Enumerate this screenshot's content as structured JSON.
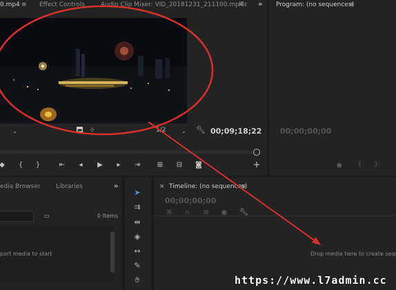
{
  "source_panel": {
    "tabs": [
      "0.mp4",
      "Effect Controls",
      "Audio Clip Mixer: VID_20181231_211100.mp4",
      "Mε"
    ],
    "menu_icon": "hamburger-icon",
    "overflow_icon": "double-chevron-right-icon",
    "timecode": "00;09;18;22",
    "resolution": "1/2",
    "controls": [
      "mark-in",
      "mark-out",
      "go-to-in",
      "step-back",
      "play",
      "step-forward",
      "go-to-out",
      "insert",
      "overwrite",
      "export-frame",
      "add"
    ]
  },
  "program_panel": {
    "title": "Program: (no sequences)",
    "menu_icon": "hamburger-icon",
    "timecode": "00;00;00;00"
  },
  "project_panel": {
    "tabs": [
      "edia Browser",
      "Libraries"
    ],
    "overflow_icon": "double-chevron-right-icon",
    "items_count": "0 Items",
    "empty_text": "port media to start"
  },
  "timeline_panel": {
    "title": "Timeline: (no sequences)",
    "close_icon": "close-icon",
    "menu_icon": "hamburger-icon",
    "timecode": "00;00;00;00",
    "drop_text": "Drop media here to create seque"
  },
  "tools": [
    "selection-tool",
    "track-select-tool",
    "ripple-edit-tool",
    "razor-tool",
    "slip-tool",
    "pen-tool",
    "hand-tool"
  ],
  "watermark": "https://www.l7admin.cc",
  "colors": {
    "annotation": "#d9302a",
    "selected_tool": "#5a8fe8",
    "timecode_blue": "#4a7fd0"
  }
}
